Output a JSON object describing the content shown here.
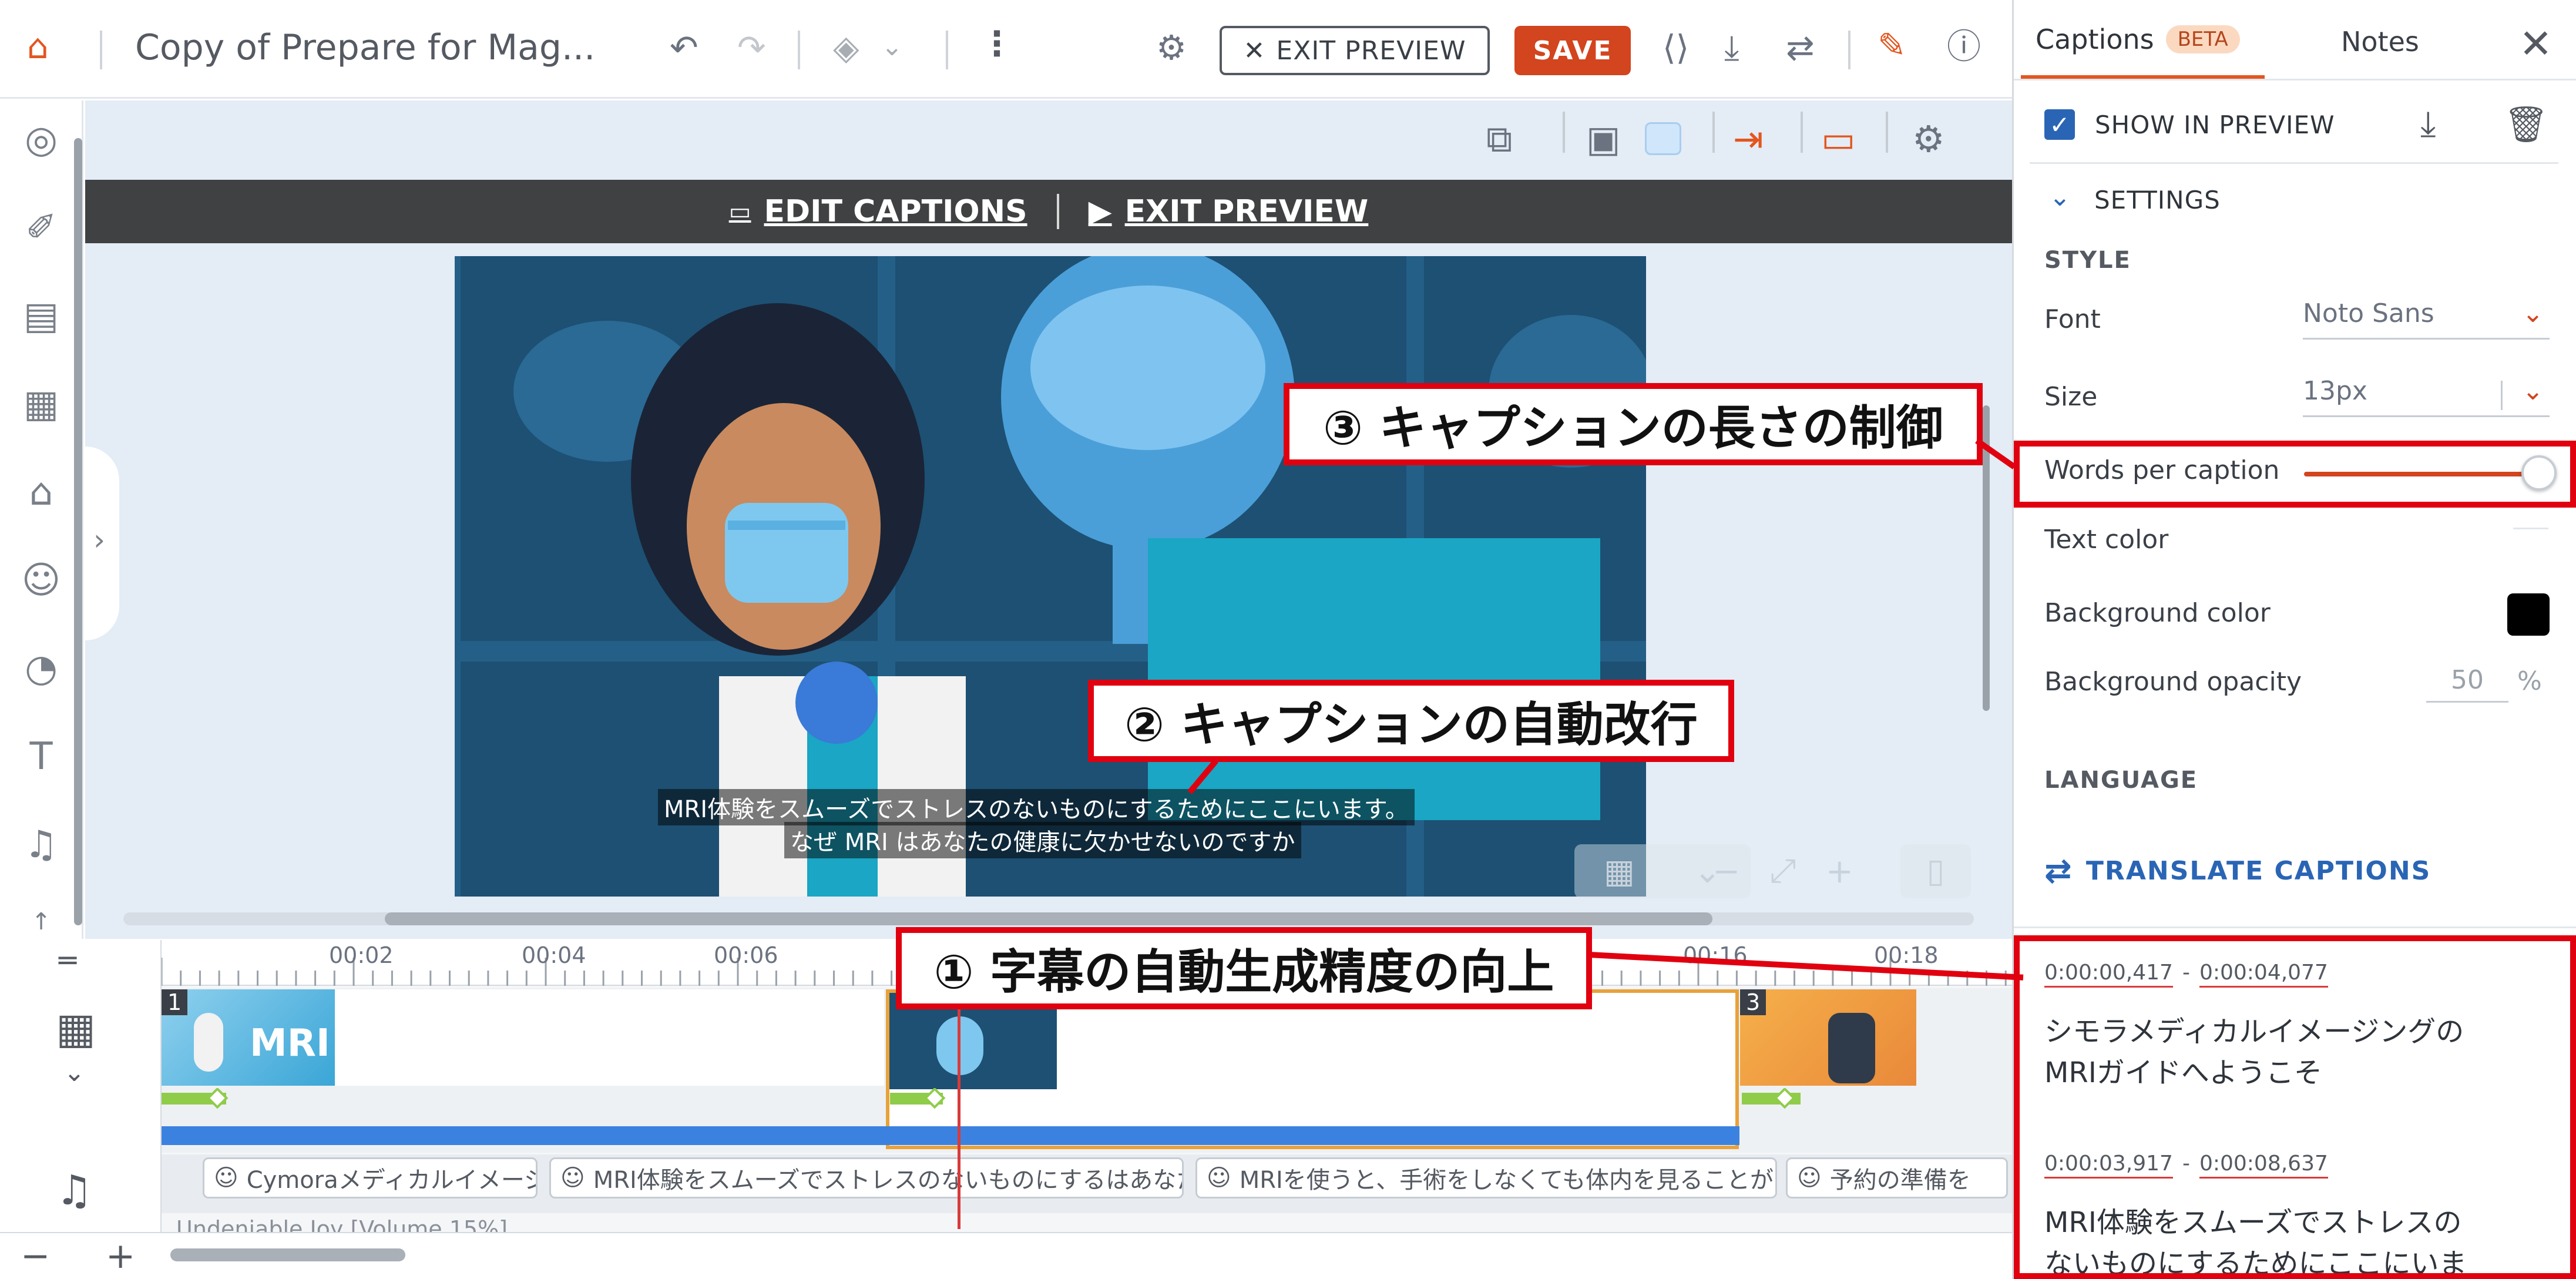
{
  "toolbar": {
    "doc_title": "Copy of Prepare for Mag...",
    "exit_preview_label": "EXIT PREVIEW",
    "save_label": "SAVE"
  },
  "preview_bar": {
    "edit_captions": "EDIT CAPTIONS",
    "exit_preview": "EXIT PREVIEW"
  },
  "video": {
    "caption_line1": "MRI体験をスムーズでストレスのないものにするためにここにいます。",
    "caption_line2": "なぜ MRI はあなたの健康に欠かせないのですか"
  },
  "timeline": {
    "ticks": [
      "00:02",
      "00:04",
      "00:06",
      "00:16",
      "00:18"
    ],
    "scene_numbers": [
      "1",
      "3"
    ],
    "scene1_text": "MRI",
    "audio_clips": [
      "Cymoraメディカルイメージ",
      "MRI体験をスムーズでストレスのないものにするはあなたの",
      "MRIを使うと、手術をしなくても体内を見ることがで",
      "予約の準備を"
    ],
    "background_audio": "Undeniable Joy [Volume 15%]"
  },
  "panel": {
    "tab_captions": "Captions",
    "beta_badge": "BETA",
    "tab_notes": "Notes",
    "show_in_preview": "SHOW IN PREVIEW",
    "settings": "SETTINGS",
    "style_section": "STYLE",
    "font_label": "Font",
    "font_value": "Noto Sans",
    "size_label": "Size",
    "size_value": "13px",
    "words_per_caption_label": "Words per caption",
    "words_per_caption_level": 1.0,
    "text_color_label": "Text color",
    "background_color_label": "Background color",
    "background_color": "#000000",
    "background_opacity_label": "Background opacity",
    "background_opacity_value": "50",
    "opacity_unit": "%",
    "language_section": "LANGUAGE",
    "translate_captions": "TRANSLATE CAPTIONS",
    "cues": [
      {
        "start": "0:00:00,417",
        "end": "0:00:04,077",
        "line1": "シモラメディカルイメージングの",
        "line2": "MRIガイドへようこそ"
      },
      {
        "start": "0:00:03,917",
        "end": "0:00:08,637",
        "line1": "MRI体験をスムーズでストレスの",
        "line2": "ないものにするためにここにいま"
      }
    ]
  },
  "annotations": {
    "one": "① 字幕の自動生成精度の向上",
    "two": "② キャプションの自動改行",
    "three": "③ キャプションの長さの制御"
  },
  "colors": {
    "accent": "#e2561f",
    "save_button": "#d2451e",
    "annotation_red": "#e0000f",
    "link_blue": "#2a65b5"
  }
}
